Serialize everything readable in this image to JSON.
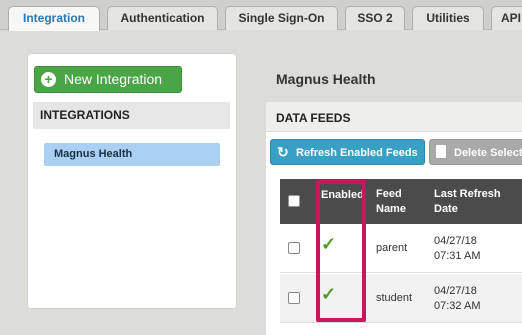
{
  "tabs": [
    {
      "label": "Integration",
      "active": true
    },
    {
      "label": "Authentication",
      "active": false
    },
    {
      "label": "Single Sign-On",
      "active": false
    },
    {
      "label": "SSO 2",
      "active": false
    },
    {
      "label": "Utilities",
      "active": false
    },
    {
      "label": "API",
      "active": false
    }
  ],
  "sidebar": {
    "new_button_label": "New Integration",
    "header": "INTEGRATIONS",
    "items": [
      {
        "label": "Magnus Health",
        "selected": true
      }
    ]
  },
  "main": {
    "title": "Magnus Health",
    "section_header": "DATA FEEDS",
    "refresh_button_label": "Refresh Enabled Feeds",
    "delete_button_label": "Delete Selected",
    "table": {
      "headers": {
        "enabled": "Enabled",
        "feed_name_1": "Feed",
        "feed_name_2": "Name",
        "last_refresh_1": "Last Refresh",
        "last_refresh_2": "Date"
      },
      "rows": [
        {
          "enabled": true,
          "check_glyph": "✓",
          "feed_name": "parent",
          "date_line1": "04/27/18",
          "date_line2": "07:31 AM"
        },
        {
          "enabled": true,
          "check_glyph": "✓",
          "feed_name": "student",
          "date_line1": "04/27/18",
          "date_line2": "07:32 AM"
        }
      ]
    }
  },
  "colors": {
    "active_tab_text": "#2a77b7",
    "new_button": "#4aa545",
    "refresh_button": "#3a9fc4",
    "delete_button": "#a9a9a9",
    "selected_item": "#a9d0f2",
    "table_header": "#4b4b4b",
    "checkmark": "#4f9a2f",
    "highlight_box": "#c8175a"
  },
  "icons": {
    "new_button": "plus-circle-icon",
    "refresh_button": "refresh-icon",
    "delete_button": "trash-icon",
    "enabled": "checkmark-icon"
  }
}
